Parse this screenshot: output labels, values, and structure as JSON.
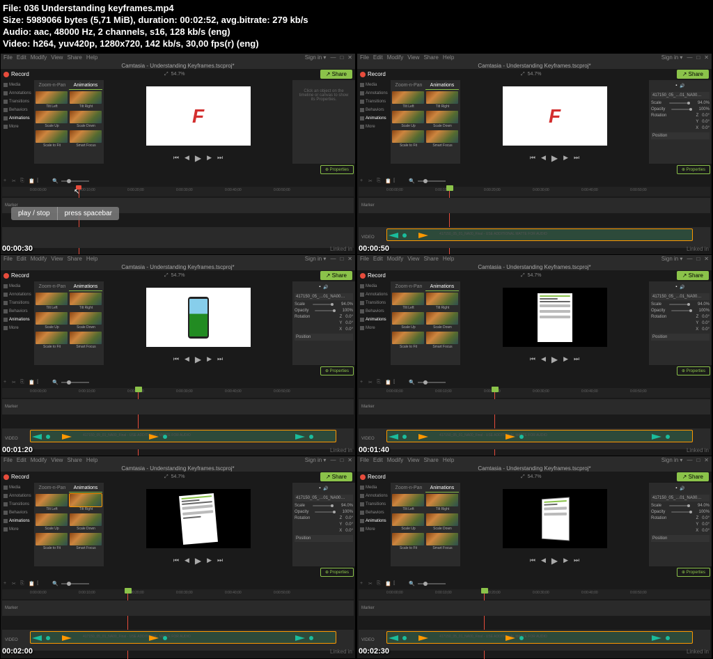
{
  "meta": {
    "file_label": "File:",
    "file_value": "036 Understanding keyframes.mp4",
    "size_label": "Size:",
    "size_value": "5989066 bytes (5,71 MiB), duration: 00:02:52, avg.bitrate: 279 kb/s",
    "audio_label": "Audio:",
    "audio_value": "aac, 48000 Hz, 2 channels, s16, 128 kb/s (eng)",
    "video_label": "Video:",
    "video_value": "h264, yuv420p, 1280x720, 142 kb/s, 30,00 fps(r) (eng)"
  },
  "app": {
    "title": "Camtasia - Understanding Keyframes.tscproj*",
    "menus": [
      "File",
      "Edit",
      "Modify",
      "View",
      "Share",
      "Help"
    ],
    "signin": "Sign in ▾",
    "record": "Record",
    "share": "↗ Share",
    "zoom_percent": "54.7%",
    "sidebar": [
      "Media",
      "Annotations",
      "Transitions",
      "Behaviors",
      "Animations",
      "More"
    ],
    "anim_tabs": [
      "Zoom-n-Pan",
      "Animations"
    ],
    "animations": [
      "Tilt Left",
      "Tilt Right",
      "Scale Up",
      "Scale Down",
      "Scale to Fit",
      "Smart Focus"
    ],
    "props_hint": "Click an object on the timeline or canvas to show its Properties.",
    "props_button": "⊕ Properties",
    "props": {
      "track_name": "417150_05_…01_NA00…",
      "scale": "Scale",
      "scale_val": "94.0%",
      "opacity": "Opacity",
      "opacity_val": "100%",
      "rotation": "Rotation",
      "rot_z": "0.0°",
      "rot_y": "0.0°",
      "rot_x": "0.0°",
      "position": "Position"
    },
    "timeline": {
      "markers": [
        "0:00:00;00",
        "0:00:10;00",
        "0:00:20;00",
        "0:00:30;00",
        "0:00:40;00",
        "0:00:50;00"
      ],
      "track2": "Marker",
      "track1": "VIDEO",
      "clip_text": "417150_05_01_NA00_Final - USE ADDITIONAL MATTE FOR AUDIO"
    },
    "tooltip": {
      "left": "play / stop",
      "right": "press spacebar"
    },
    "linkedin": "Linked in"
  },
  "timestamps": [
    "00:00:30",
    "00:00:50",
    "00:01:20",
    "00:01:40",
    "00:02:00",
    "00:02:30"
  ]
}
